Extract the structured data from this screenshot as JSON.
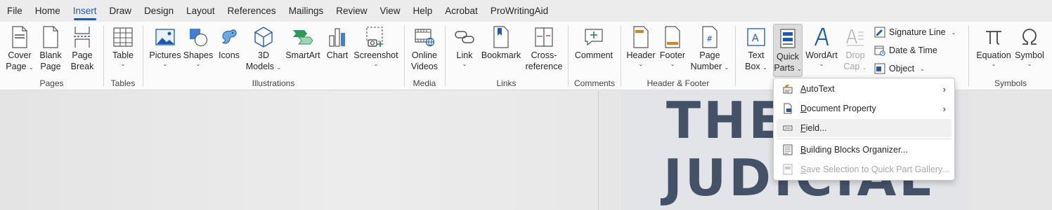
{
  "tabs": [
    "File",
    "Home",
    "Insert",
    "Draw",
    "Design",
    "Layout",
    "References",
    "Mailings",
    "Review",
    "View",
    "Help",
    "Acrobat",
    "ProWritingAid"
  ],
  "active_tab": "Insert",
  "ribbon": {
    "pages": {
      "label": "Pages",
      "cover": [
        "Cover",
        "Page"
      ],
      "blank": [
        "Blank",
        "Page"
      ],
      "break": [
        "Page",
        "Break"
      ]
    },
    "tables": {
      "label": "Tables",
      "table": "Table"
    },
    "illustrations": {
      "label": "Illustrations",
      "pictures": "Pictures",
      "shapes": "Shapes",
      "icons": "Icons",
      "models": [
        "3D",
        "Models"
      ],
      "smartart": "SmartArt",
      "chart": "Chart",
      "screenshot": "Screenshot"
    },
    "media": {
      "label": "Media",
      "online_videos": [
        "Online",
        "Videos"
      ]
    },
    "links": {
      "label": "Links",
      "link": "Link",
      "bookmark": "Bookmark",
      "cross_reference": [
        "Cross-",
        "reference"
      ]
    },
    "comments": {
      "label": "Comments",
      "comment": "Comment"
    },
    "header_footer": {
      "label": "Header & Footer",
      "header": "Header",
      "footer": "Footer",
      "page_number": [
        "Page",
        "Number"
      ]
    },
    "text": {
      "text_box": [
        "Text",
        "Box"
      ],
      "quick_parts": [
        "Quick",
        "Parts"
      ],
      "wordart": "WordArt",
      "drop_cap": [
        "Drop",
        "Cap"
      ],
      "signature_line": "Signature Line",
      "date_time": "Date & Time",
      "object": "Object"
    },
    "symbols": {
      "label": "Symbols",
      "equation": "Equation",
      "symbol": "Symbol"
    }
  },
  "document": {
    "line1": "THE",
    "line2": "JUDICIAL"
  },
  "menu": {
    "autotext": {
      "u": "A",
      "rest": "utoText"
    },
    "document_property": {
      "u": "D",
      "rest": "ocument Property"
    },
    "field": {
      "u": "F",
      "rest": "ield..."
    },
    "building_blocks": {
      "u": "B",
      "rest": "uilding Blocks Organizer..."
    },
    "save_selection": {
      "u": "S",
      "rest": "ave Selection to Quick Part Gallery..."
    }
  },
  "colors": {
    "accent": "#185abd",
    "doc_text": "#445268"
  }
}
